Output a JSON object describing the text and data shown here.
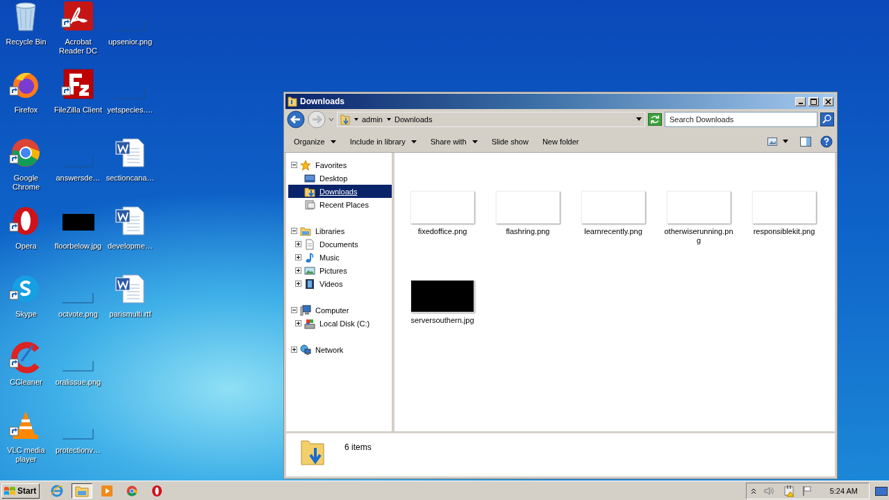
{
  "desktop": {
    "icons": [
      {
        "label": "Recycle Bin",
        "kind": "trash",
        "shortcut": false
      },
      {
        "label": "Firefox",
        "kind": "firefox",
        "shortcut": true
      },
      {
        "label": "Google Chrome",
        "kind": "chrome",
        "shortcut": true
      },
      {
        "label": "Opera",
        "kind": "opera",
        "shortcut": true
      },
      {
        "label": "Skype",
        "kind": "skype",
        "shortcut": true
      },
      {
        "label": "CCleaner",
        "kind": "ccleaner",
        "shortcut": true
      },
      {
        "label": "VLC media player",
        "kind": "vlc",
        "shortcut": true
      },
      {
        "label": "Acrobat Reader DC",
        "kind": "acrobat",
        "shortcut": true
      },
      {
        "label": "FileZilla Client",
        "kind": "filezilla",
        "shortcut": true
      },
      {
        "label": "answersde…",
        "kind": "blank",
        "shortcut": false
      },
      {
        "label": "floorbelow.jpg",
        "kind": "dark",
        "shortcut": false
      },
      {
        "label": "octvote.png",
        "kind": "blank",
        "shortcut": false
      },
      {
        "label": "oralissue.png",
        "kind": "blank",
        "shortcut": false
      },
      {
        "label": "protectionv…",
        "kind": "blank",
        "shortcut": false
      },
      {
        "label": "upsenior.png",
        "kind": "blank",
        "shortcut": false
      },
      {
        "label": "yetspecies.…",
        "kind": "blank",
        "shortcut": false
      },
      {
        "label": "sectioncana…",
        "kind": "word",
        "shortcut": false
      },
      {
        "label": "developme…",
        "kind": "word",
        "shortcut": false
      },
      {
        "label": "parismulti.rtf",
        "kind": "word",
        "shortcut": false
      }
    ]
  },
  "window": {
    "title": "Downloads",
    "address": [
      "admin",
      "Downloads"
    ],
    "search": {
      "placeholder": "Search Downloads"
    },
    "toolbar": [
      {
        "label": "Organize",
        "dropdown": true
      },
      {
        "label": "Include in library",
        "dropdown": true
      },
      {
        "label": "Share with",
        "dropdown": true
      },
      {
        "label": "Slide show",
        "dropdown": false
      },
      {
        "label": "New folder",
        "dropdown": false
      }
    ],
    "nav": [
      {
        "label": "Favorites",
        "kind": "star",
        "expanded": true,
        "selected": false,
        "children": [
          {
            "label": "Desktop",
            "kind": "desktop",
            "selected": false
          },
          {
            "label": "Downloads",
            "kind": "downloads",
            "selected": true
          },
          {
            "label": "Recent Places",
            "kind": "recent",
            "selected": false
          }
        ]
      },
      {
        "label": "Libraries",
        "kind": "library",
        "expanded": true,
        "selected": false,
        "children": [
          {
            "label": "Documents",
            "kind": "documents",
            "expanded": false,
            "selected": false
          },
          {
            "label": "Music",
            "kind": "music",
            "expanded": false,
            "selected": false
          },
          {
            "label": "Pictures",
            "kind": "pictures",
            "expanded": false,
            "selected": false
          },
          {
            "label": "Videos",
            "kind": "videos",
            "expanded": false,
            "selected": false
          }
        ]
      },
      {
        "label": "Computer",
        "kind": "computer",
        "expanded": true,
        "selected": false,
        "children": [
          {
            "label": "Local Disk (C:)",
            "kind": "disk",
            "expanded": false,
            "selected": false
          }
        ]
      },
      {
        "label": "Network",
        "kind": "network",
        "expanded": false,
        "selected": false
      }
    ],
    "files": [
      {
        "name": "fixedoffice.png",
        "kind": "light"
      },
      {
        "name": "flashring.png",
        "kind": "light"
      },
      {
        "name": "learnrecently.png",
        "kind": "light"
      },
      {
        "name": "otherwiserunning.png",
        "kind": "light"
      },
      {
        "name": "responsiblekit.png",
        "kind": "light"
      },
      {
        "name": "serversouthern.jpg",
        "kind": "dark"
      }
    ],
    "status": "6 items"
  },
  "taskbar": {
    "start": "Start",
    "apps": [
      {
        "kind": "ie",
        "selected": false
      },
      {
        "kind": "explorer",
        "selected": true
      },
      {
        "kind": "media",
        "selected": false
      },
      {
        "kind": "chrome",
        "selected": false
      },
      {
        "kind": "opera",
        "selected": false
      }
    ],
    "clock": "5:24 AM"
  }
}
